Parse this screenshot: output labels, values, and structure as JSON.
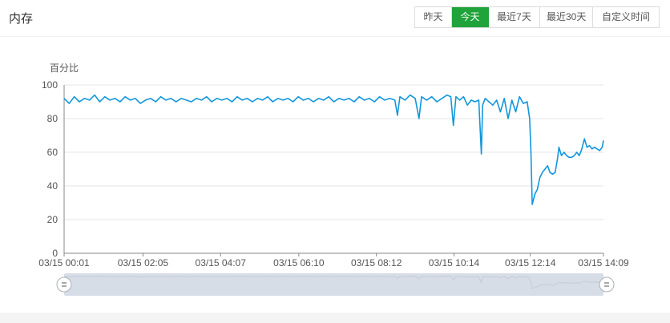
{
  "panel": {
    "title": "内存"
  },
  "range_buttons": [
    {
      "label": "昨天",
      "active": false
    },
    {
      "label": "今天",
      "active": true
    },
    {
      "label": "最近7天",
      "active": false
    },
    {
      "label": "最近30天",
      "active": false
    },
    {
      "label": "自定义时间",
      "active": false
    }
  ],
  "colors": {
    "accent": "#1fa33a",
    "line": "#1296db",
    "grid": "#e6e6e6",
    "zoom_fill": "#d7dde7"
  },
  "chart_data": {
    "type": "line",
    "title": "",
    "ylabel": "百分比",
    "xlabel": "",
    "ylim": [
      0,
      100
    ],
    "yticks": [
      0,
      20,
      40,
      60,
      80,
      100
    ],
    "xticks": [
      "03/15 00:01",
      "03/15 02:05",
      "03/15 04:07",
      "03/15 06:10",
      "03/15 08:12",
      "03/15 10:14",
      "03/15 12:14",
      "03/15 14:09"
    ],
    "x_minutes": [
      0,
      124,
      246,
      369,
      491,
      613,
      733,
      848
    ],
    "x_range_minutes": [
      0,
      848
    ],
    "grid": true,
    "has_zoom_slider": true,
    "series": [
      {
        "points": [
          [
            0,
            92
          ],
          [
            8,
            89
          ],
          [
            16,
            93
          ],
          [
            24,
            90
          ],
          [
            32,
            92
          ],
          [
            40,
            91
          ],
          [
            48,
            94
          ],
          [
            56,
            90
          ],
          [
            64,
            93
          ],
          [
            72,
            91
          ],
          [
            80,
            92
          ],
          [
            88,
            90
          ],
          [
            96,
            93
          ],
          [
            104,
            91
          ],
          [
            112,
            92
          ],
          [
            120,
            89
          ],
          [
            128,
            91
          ],
          [
            136,
            92
          ],
          [
            144,
            90
          ],
          [
            152,
            93
          ],
          [
            160,
            91
          ],
          [
            168,
            92
          ],
          [
            176,
            90
          ],
          [
            184,
            92
          ],
          [
            192,
            91
          ],
          [
            200,
            90
          ],
          [
            208,
            92
          ],
          [
            216,
            91
          ],
          [
            224,
            93
          ],
          [
            232,
            90
          ],
          [
            240,
            92
          ],
          [
            248,
            91
          ],
          [
            256,
            92
          ],
          [
            264,
            90
          ],
          [
            272,
            93
          ],
          [
            280,
            91
          ],
          [
            288,
            92
          ],
          [
            296,
            90
          ],
          [
            304,
            92
          ],
          [
            312,
            91
          ],
          [
            320,
            93
          ],
          [
            328,
            90
          ],
          [
            336,
            92
          ],
          [
            344,
            91
          ],
          [
            352,
            92
          ],
          [
            360,
            90
          ],
          [
            368,
            93
          ],
          [
            376,
            91
          ],
          [
            384,
            92
          ],
          [
            392,
            90
          ],
          [
            400,
            92
          ],
          [
            408,
            91
          ],
          [
            416,
            93
          ],
          [
            424,
            90
          ],
          [
            432,
            92
          ],
          [
            440,
            91
          ],
          [
            448,
            92
          ],
          [
            456,
            90
          ],
          [
            464,
            93
          ],
          [
            472,
            91
          ],
          [
            480,
            92
          ],
          [
            488,
            90
          ],
          [
            496,
            93
          ],
          [
            504,
            91
          ],
          [
            512,
            92
          ],
          [
            520,
            91
          ],
          [
            524,
            82
          ],
          [
            528,
            93
          ],
          [
            536,
            91
          ],
          [
            544,
            94
          ],
          [
            552,
            92
          ],
          [
            558,
            80
          ],
          [
            562,
            93
          ],
          [
            570,
            91
          ],
          [
            578,
            93
          ],
          [
            586,
            90
          ],
          [
            594,
            92
          ],
          [
            602,
            94
          ],
          [
            608,
            93
          ],
          [
            612,
            76
          ],
          [
            616,
            93
          ],
          [
            622,
            91
          ],
          [
            628,
            93
          ],
          [
            634,
            88
          ],
          [
            640,
            91
          ],
          [
            646,
            90
          ],
          [
            652,
            91
          ],
          [
            656,
            59
          ],
          [
            658,
            88
          ],
          [
            662,
            92
          ],
          [
            668,
            90
          ],
          [
            674,
            88
          ],
          [
            680,
            91
          ],
          [
            686,
            84
          ],
          [
            692,
            92
          ],
          [
            698,
            80
          ],
          [
            704,
            91
          ],
          [
            710,
            84
          ],
          [
            716,
            93
          ],
          [
            722,
            89
          ],
          [
            728,
            90
          ],
          [
            732,
            80
          ],
          [
            734,
            60
          ],
          [
            736,
            29
          ],
          [
            740,
            35
          ],
          [
            744,
            38
          ],
          [
            748,
            45
          ],
          [
            752,
            48
          ],
          [
            756,
            50
          ],
          [
            760,
            52
          ],
          [
            764,
            48
          ],
          [
            768,
            47
          ],
          [
            772,
            48
          ],
          [
            776,
            57
          ],
          [
            778,
            63
          ],
          [
            782,
            58
          ],
          [
            786,
            60
          ],
          [
            790,
            58
          ],
          [
            794,
            57
          ],
          [
            798,
            57
          ],
          [
            802,
            58
          ],
          [
            806,
            60
          ],
          [
            810,
            58
          ],
          [
            814,
            62
          ],
          [
            818,
            68
          ],
          [
            822,
            63
          ],
          [
            826,
            64
          ],
          [
            830,
            62
          ],
          [
            834,
            63
          ],
          [
            838,
            62
          ],
          [
            842,
            61
          ],
          [
            846,
            63
          ],
          [
            848,
            67
          ]
        ]
      }
    ]
  }
}
